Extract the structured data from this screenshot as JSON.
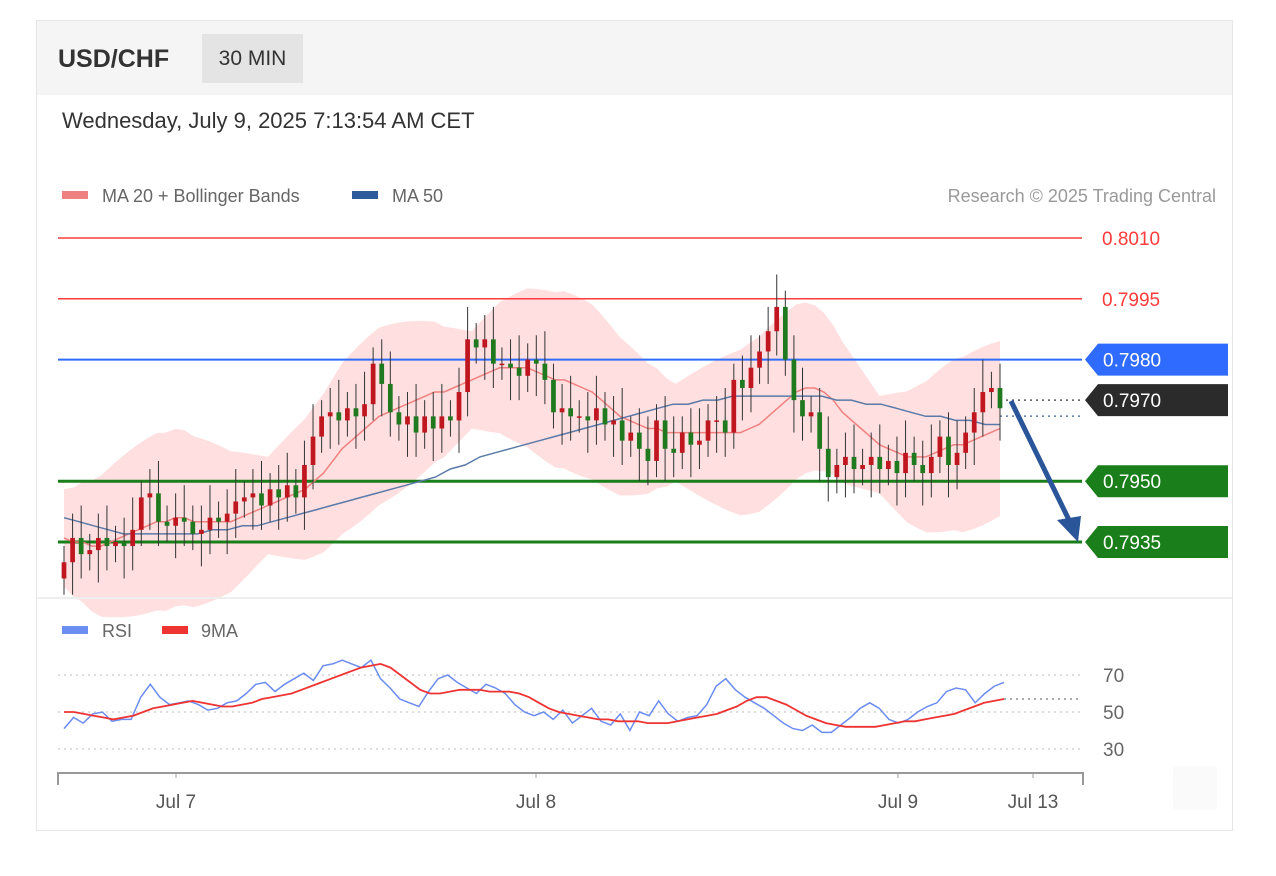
{
  "header": {
    "symbol": "USD/CHF",
    "timeframe": "30 MIN"
  },
  "datetime": "Wednesday, July 9, 2025 7:13:54 AM CET",
  "legend": {
    "ma20": "MA 20 + Bollinger Bands",
    "ma50": "MA 50",
    "credit": "Research © 2025 Trading Central",
    "rsi": "RSI",
    "rsi_ma": "9MA"
  },
  "colors": {
    "resistance": "#ff3b3b",
    "pivot": "#2f6bff",
    "support": "#1a7f1a",
    "current": "#2b2b2b",
    "candle_up": "#c0161f",
    "candle_down": "#1f7a1f",
    "bollinger_fill": "#ffd9d9",
    "ma20": "#f08080",
    "ma50": "#5a7aa8",
    "rsi": "#6b8cf0",
    "rsi_ma": "#ee3333",
    "arrow": "#2a5599"
  },
  "chart_data": [
    {
      "type": "candlestick",
      "ylim": [
        0.7922,
        0.8017
      ],
      "x_ticks": [
        "Jul 7",
        "Jul 8",
        "Jul 9",
        "Jul 13"
      ],
      "levels": [
        {
          "label": "0.8010",
          "value": 0.801,
          "kind": "resistance"
        },
        {
          "label": "0.7995",
          "value": 0.7995,
          "kind": "resistance"
        },
        {
          "label": "0.7980",
          "value": 0.798,
          "kind": "pivot"
        },
        {
          "label": "0.7970",
          "value": 0.797,
          "kind": "current"
        },
        {
          "label": "0.7950",
          "value": 0.795,
          "kind": "support"
        },
        {
          "label": "0.7935",
          "value": 0.7935,
          "kind": "support"
        }
      ],
      "closes": [
        0.793,
        0.7936,
        0.7932,
        0.7933,
        0.7936,
        0.7934,
        0.7935,
        0.7934,
        0.7938,
        0.7946,
        0.7947,
        0.794,
        0.7939,
        0.7941,
        0.794,
        0.7937,
        0.7938,
        0.7941,
        0.794,
        0.7942,
        0.7945,
        0.7946,
        0.7947,
        0.7944,
        0.7948,
        0.7946,
        0.7949,
        0.7946,
        0.7954,
        0.7961,
        0.7966,
        0.7967,
        0.7965,
        0.7968,
        0.7966,
        0.7969,
        0.7979,
        0.7974,
        0.7967,
        0.7964,
        0.7966,
        0.7962,
        0.7966,
        0.7963,
        0.7966,
        0.7965,
        0.7972,
        0.7985,
        0.7983,
        0.7985,
        0.7979,
        0.7979,
        0.7978,
        0.7976,
        0.798,
        0.7979,
        0.7975,
        0.7967,
        0.7968,
        0.7966,
        0.7966,
        0.7965,
        0.7968,
        0.7964,
        0.7965,
        0.796,
        0.7962,
        0.7958,
        0.7955,
        0.7965,
        0.7958,
        0.7957,
        0.7962,
        0.7959,
        0.796,
        0.7965,
        0.7965,
        0.7962,
        0.7975,
        0.7973,
        0.7978,
        0.7982,
        0.7987,
        0.7993,
        0.798,
        0.797,
        0.7966,
        0.7967,
        0.7958,
        0.7951,
        0.7954,
        0.7956,
        0.7953,
        0.7954,
        0.7956,
        0.7953,
        0.7955,
        0.7952,
        0.7957,
        0.7954,
        0.7952,
        0.7956,
        0.7961,
        0.7954,
        0.7957,
        0.7962,
        0.7967,
        0.7972,
        0.7973,
        0.7968
      ],
      "ma20": [
        0.7936,
        0.7935,
        0.7935,
        0.7934,
        0.7934,
        0.7935,
        0.7936,
        0.7937,
        0.7938,
        0.7939,
        0.794,
        0.794,
        0.7941,
        0.7941,
        0.794,
        0.794,
        0.794,
        0.794,
        0.794,
        0.7941,
        0.7942,
        0.7943,
        0.7944,
        0.7945,
        0.7946,
        0.7947,
        0.7948,
        0.795,
        0.7952,
        0.7955,
        0.7958,
        0.796,
        0.7962,
        0.7964,
        0.7966,
        0.7967,
        0.7968,
        0.7969,
        0.797,
        0.7971,
        0.7972,
        0.7972,
        0.7973,
        0.7974,
        0.7975,
        0.7976,
        0.7977,
        0.7978,
        0.7978,
        0.7978,
        0.7978,
        0.7977,
        0.7976,
        0.7975,
        0.7975,
        0.7974,
        0.7973,
        0.7972,
        0.797,
        0.7968,
        0.7966,
        0.7965,
        0.7964,
        0.7963,
        0.7963,
        0.7962,
        0.7962,
        0.7962,
        0.7962,
        0.7962,
        0.7962,
        0.7962,
        0.7962,
        0.7962,
        0.7963,
        0.7964,
        0.7966,
        0.7968,
        0.797,
        0.7972,
        0.7973,
        0.7973,
        0.7972,
        0.797,
        0.7967,
        0.7965,
        0.7963,
        0.7961,
        0.7959,
        0.7958,
        0.7957,
        0.7956,
        0.7956,
        0.7956,
        0.7957,
        0.7958,
        0.7959,
        0.7959,
        0.796,
        0.7961,
        0.7962,
        0.7963
      ],
      "ma50": [
        0.7941,
        0.794,
        0.7939,
        0.7938,
        0.7937,
        0.7937,
        0.7937,
        0.7937,
        0.7937,
        0.7937,
        0.7938,
        0.7938,
        0.7939,
        0.7939,
        0.794,
        0.7941,
        0.7942,
        0.7943,
        0.7944,
        0.7945,
        0.7946,
        0.7947,
        0.7948,
        0.7949,
        0.795,
        0.7951,
        0.7953,
        0.7954,
        0.7956,
        0.7957,
        0.7958,
        0.7959,
        0.796,
        0.7961,
        0.7962,
        0.7963,
        0.7964,
        0.7965,
        0.7966,
        0.7967,
        0.7968,
        0.7969,
        0.7969,
        0.797,
        0.797,
        0.7971,
        0.7971,
        0.7971,
        0.7971,
        0.7971,
        0.7971,
        0.7971,
        0.797,
        0.797,
        0.7969,
        0.7969,
        0.7968,
        0.7967,
        0.7966,
        0.7966,
        0.7965,
        0.7965,
        0.7964,
        0.7964
      ]
    },
    {
      "type": "line",
      "title": "RSI",
      "ylim": [
        20,
        85
      ],
      "y_ticks": [
        70,
        50,
        30
      ],
      "series": [
        {
          "name": "RSI",
          "values": [
            41,
            47,
            44,
            49,
            50,
            45,
            46,
            46,
            58,
            65,
            58,
            54,
            55,
            56,
            54,
            51,
            52,
            55,
            56,
            60,
            65,
            66,
            61,
            65,
            68,
            71,
            67,
            75,
            76,
            78,
            76,
            74,
            78,
            68,
            63,
            57,
            55,
            53,
            61,
            68,
            70,
            66,
            63,
            60,
            65,
            63,
            60,
            54,
            50,
            48,
            50,
            46,
            51,
            44,
            48,
            52,
            45,
            43,
            49,
            40,
            50,
            48,
            56,
            49,
            45,
            47,
            48,
            54,
            64,
            68,
            62,
            58,
            55,
            52,
            48,
            44,
            41,
            40,
            43,
            39,
            39,
            43,
            47,
            52,
            55,
            52,
            46,
            44,
            46,
            50,
            53,
            55,
            61,
            63,
            62,
            55,
            60,
            64,
            66
          ]
        },
        {
          "name": "9MA",
          "values": [
            50,
            50,
            49,
            48,
            47,
            46,
            47,
            48,
            50,
            52,
            53,
            54,
            55,
            56,
            55,
            54,
            53,
            53,
            54,
            55,
            57,
            58,
            59,
            60,
            62,
            64,
            66,
            68,
            70,
            72,
            74,
            75,
            76,
            74,
            70,
            66,
            62,
            60,
            60,
            61,
            62,
            62,
            62,
            61,
            61,
            61,
            60,
            58,
            55,
            52,
            50,
            49,
            48,
            47,
            46,
            46,
            45,
            45,
            45,
            44,
            44,
            44,
            45,
            46,
            47,
            48,
            49,
            51,
            53,
            56,
            58,
            58,
            56,
            54,
            51,
            48,
            46,
            44,
            43,
            42,
            42,
            42,
            42,
            43,
            44,
            45,
            45,
            46,
            47,
            48,
            49,
            51,
            53,
            55,
            56,
            57
          ]
        }
      ]
    }
  ]
}
